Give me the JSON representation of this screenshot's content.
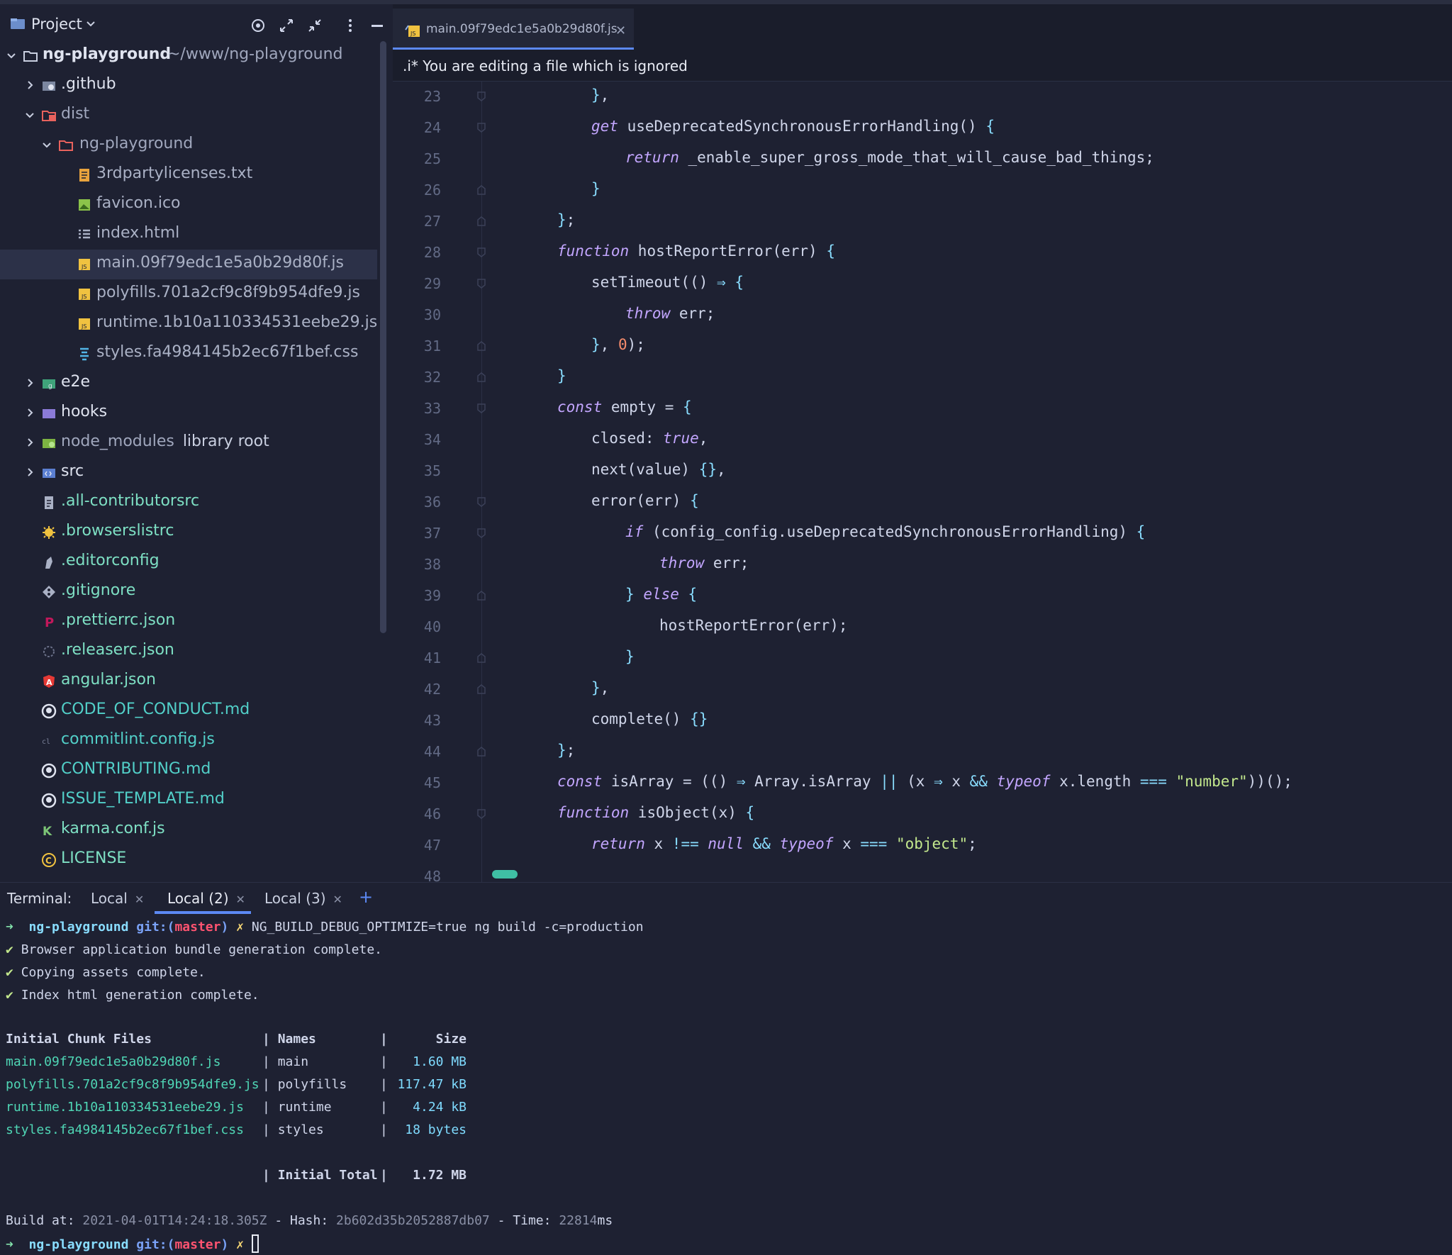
{
  "project_panel": {
    "title": "Project",
    "tree": [
      {
        "label": "ng-playground",
        "suffix": "~/www/ng-playground",
        "icon": "folder-icon"
      },
      {
        "label": ".github",
        "icon": "github-folder-icon"
      },
      {
        "label": "dist",
        "icon": "dist-folder-icon"
      },
      {
        "label": "ng-playground",
        "icon": "folder-icon"
      },
      {
        "label": "3rdpartylicenses.txt",
        "icon": "text-file-icon"
      },
      {
        "label": "favicon.ico",
        "icon": "image-file-icon"
      },
      {
        "label": "index.html",
        "icon": "html-file-icon"
      },
      {
        "label": "main.09f79edc1e5a0b29d80f.js",
        "icon": "js-file-icon"
      },
      {
        "label": "polyfills.701a2cf9c8f9b954dfe9.js",
        "icon": "js-file-icon"
      },
      {
        "label": "runtime.1b10a110334531eebe29.js",
        "icon": "js-file-icon"
      },
      {
        "label": "styles.fa4984145b2ec67f1bef.css",
        "icon": "css-file-icon"
      },
      {
        "label": "e2e",
        "icon": "test-folder-icon"
      },
      {
        "label": "hooks",
        "icon": "hooks-folder-icon"
      },
      {
        "label": "node_modules",
        "suffix": "library root",
        "icon": "node-modules-folder-icon"
      },
      {
        "label": "src",
        "icon": "src-folder-icon"
      },
      {
        "label": ".all-contributorsrc",
        "icon": "document-icon"
      },
      {
        "label": ".browserslistrc",
        "icon": "browserslist-icon"
      },
      {
        "label": ".editorconfig",
        "icon": "editorconfig-icon"
      },
      {
        "label": ".gitignore",
        "icon": "git-icon"
      },
      {
        "label": ".prettierrc.json",
        "icon": "prettier-icon"
      },
      {
        "label": ".releaserc.json",
        "icon": "release-icon"
      },
      {
        "label": "angular.json",
        "icon": "angular-icon"
      },
      {
        "label": "CODE_OF_CONDUCT.md",
        "icon": "github-icon"
      },
      {
        "label": "commitlint.config.js",
        "icon": "commitlint-icon"
      },
      {
        "label": "CONTRIBUTING.md",
        "icon": "github-icon"
      },
      {
        "label": "ISSUE_TEMPLATE.md",
        "icon": "github-icon"
      },
      {
        "label": "karma.conf.js",
        "icon": "karma-icon"
      },
      {
        "label": "LICENSE",
        "icon": "license-icon"
      }
    ]
  },
  "editor": {
    "tab_label": "main.09f79edc1e5a0b29d80f.js",
    "notice": ".i* You are editing a file which is ignored",
    "line_numbers": [
      "23",
      "24",
      "25",
      "26",
      "27",
      "28",
      "29",
      "30",
      "31",
      "32",
      "33",
      "34",
      "35",
      "36",
      "37",
      "38",
      "39",
      "40",
      "41",
      "42",
      "43",
      "44",
      "45",
      "46",
      "47",
      "48"
    ]
  },
  "terminal": {
    "label": "Terminal:",
    "tabs": [
      "Local",
      "Local (2)",
      "Local (3)"
    ],
    "prompt_project": "ng-playground",
    "prompt_git": "git:(",
    "prompt_branch": "master",
    "prompt_git_close": ")",
    "command": "NG_BUILD_DEBUG_OPTIMIZE=true ng build -c=production",
    "messages": [
      "Browser application bundle generation complete.",
      "Copying assets complete.",
      "Index html generation complete."
    ],
    "table_header": [
      "Initial Chunk Files",
      "Names",
      "Size"
    ],
    "table_rows": [
      {
        "file": "main.09f79edc1e5a0b29d80f.js",
        "name": "main",
        "size": "1.60 MB"
      },
      {
        "file": "polyfills.701a2cf9c8f9b954dfe9.js",
        "name": "polyfills",
        "size": "117.47 kB"
      },
      {
        "file": "runtime.1b10a110334531eebe29.js",
        "name": "runtime",
        "size": "4.24 kB"
      },
      {
        "file": "styles.fa4984145b2ec67f1bef.css",
        "name": "styles",
        "size": "18 bytes"
      }
    ],
    "total_label": "Initial Total",
    "total_size": "1.72 MB",
    "build_at_label": "Build at:",
    "build_at": "2021-04-01T14:24:18.305Z",
    "hash_label": "Hash:",
    "hash": "2b602d35b2052887db07",
    "time_label": "Time:",
    "time": "22814",
    "time_unit": "ms"
  }
}
